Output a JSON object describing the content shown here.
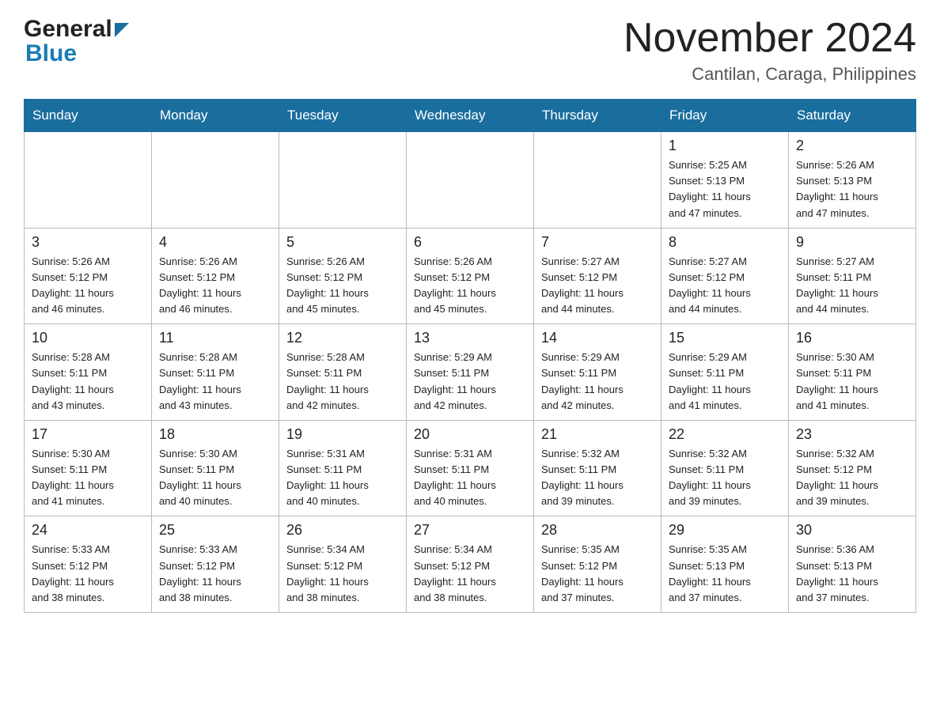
{
  "header": {
    "month_year": "November 2024",
    "location": "Cantilan, Caraga, Philippines",
    "logo_general": "General",
    "logo_blue": "Blue"
  },
  "weekdays": [
    "Sunday",
    "Monday",
    "Tuesday",
    "Wednesday",
    "Thursday",
    "Friday",
    "Saturday"
  ],
  "weeks": [
    {
      "days": [
        {
          "num": "",
          "info": ""
        },
        {
          "num": "",
          "info": ""
        },
        {
          "num": "",
          "info": ""
        },
        {
          "num": "",
          "info": ""
        },
        {
          "num": "",
          "info": ""
        },
        {
          "num": "1",
          "info": "Sunrise: 5:25 AM\nSunset: 5:13 PM\nDaylight: 11 hours\nand 47 minutes."
        },
        {
          "num": "2",
          "info": "Sunrise: 5:26 AM\nSunset: 5:13 PM\nDaylight: 11 hours\nand 47 minutes."
        }
      ]
    },
    {
      "days": [
        {
          "num": "3",
          "info": "Sunrise: 5:26 AM\nSunset: 5:12 PM\nDaylight: 11 hours\nand 46 minutes."
        },
        {
          "num": "4",
          "info": "Sunrise: 5:26 AM\nSunset: 5:12 PM\nDaylight: 11 hours\nand 46 minutes."
        },
        {
          "num": "5",
          "info": "Sunrise: 5:26 AM\nSunset: 5:12 PM\nDaylight: 11 hours\nand 45 minutes."
        },
        {
          "num": "6",
          "info": "Sunrise: 5:26 AM\nSunset: 5:12 PM\nDaylight: 11 hours\nand 45 minutes."
        },
        {
          "num": "7",
          "info": "Sunrise: 5:27 AM\nSunset: 5:12 PM\nDaylight: 11 hours\nand 44 minutes."
        },
        {
          "num": "8",
          "info": "Sunrise: 5:27 AM\nSunset: 5:12 PM\nDaylight: 11 hours\nand 44 minutes."
        },
        {
          "num": "9",
          "info": "Sunrise: 5:27 AM\nSunset: 5:11 PM\nDaylight: 11 hours\nand 44 minutes."
        }
      ]
    },
    {
      "days": [
        {
          "num": "10",
          "info": "Sunrise: 5:28 AM\nSunset: 5:11 PM\nDaylight: 11 hours\nand 43 minutes."
        },
        {
          "num": "11",
          "info": "Sunrise: 5:28 AM\nSunset: 5:11 PM\nDaylight: 11 hours\nand 43 minutes."
        },
        {
          "num": "12",
          "info": "Sunrise: 5:28 AM\nSunset: 5:11 PM\nDaylight: 11 hours\nand 42 minutes."
        },
        {
          "num": "13",
          "info": "Sunrise: 5:29 AM\nSunset: 5:11 PM\nDaylight: 11 hours\nand 42 minutes."
        },
        {
          "num": "14",
          "info": "Sunrise: 5:29 AM\nSunset: 5:11 PM\nDaylight: 11 hours\nand 42 minutes."
        },
        {
          "num": "15",
          "info": "Sunrise: 5:29 AM\nSunset: 5:11 PM\nDaylight: 11 hours\nand 41 minutes."
        },
        {
          "num": "16",
          "info": "Sunrise: 5:30 AM\nSunset: 5:11 PM\nDaylight: 11 hours\nand 41 minutes."
        }
      ]
    },
    {
      "days": [
        {
          "num": "17",
          "info": "Sunrise: 5:30 AM\nSunset: 5:11 PM\nDaylight: 11 hours\nand 41 minutes."
        },
        {
          "num": "18",
          "info": "Sunrise: 5:30 AM\nSunset: 5:11 PM\nDaylight: 11 hours\nand 40 minutes."
        },
        {
          "num": "19",
          "info": "Sunrise: 5:31 AM\nSunset: 5:11 PM\nDaylight: 11 hours\nand 40 minutes."
        },
        {
          "num": "20",
          "info": "Sunrise: 5:31 AM\nSunset: 5:11 PM\nDaylight: 11 hours\nand 40 minutes."
        },
        {
          "num": "21",
          "info": "Sunrise: 5:32 AM\nSunset: 5:11 PM\nDaylight: 11 hours\nand 39 minutes."
        },
        {
          "num": "22",
          "info": "Sunrise: 5:32 AM\nSunset: 5:11 PM\nDaylight: 11 hours\nand 39 minutes."
        },
        {
          "num": "23",
          "info": "Sunrise: 5:32 AM\nSunset: 5:12 PM\nDaylight: 11 hours\nand 39 minutes."
        }
      ]
    },
    {
      "days": [
        {
          "num": "24",
          "info": "Sunrise: 5:33 AM\nSunset: 5:12 PM\nDaylight: 11 hours\nand 38 minutes."
        },
        {
          "num": "25",
          "info": "Sunrise: 5:33 AM\nSunset: 5:12 PM\nDaylight: 11 hours\nand 38 minutes."
        },
        {
          "num": "26",
          "info": "Sunrise: 5:34 AM\nSunset: 5:12 PM\nDaylight: 11 hours\nand 38 minutes."
        },
        {
          "num": "27",
          "info": "Sunrise: 5:34 AM\nSunset: 5:12 PM\nDaylight: 11 hours\nand 38 minutes."
        },
        {
          "num": "28",
          "info": "Sunrise: 5:35 AM\nSunset: 5:12 PM\nDaylight: 11 hours\nand 37 minutes."
        },
        {
          "num": "29",
          "info": "Sunrise: 5:35 AM\nSunset: 5:13 PM\nDaylight: 11 hours\nand 37 minutes."
        },
        {
          "num": "30",
          "info": "Sunrise: 5:36 AM\nSunset: 5:13 PM\nDaylight: 11 hours\nand 37 minutes."
        }
      ]
    }
  ]
}
